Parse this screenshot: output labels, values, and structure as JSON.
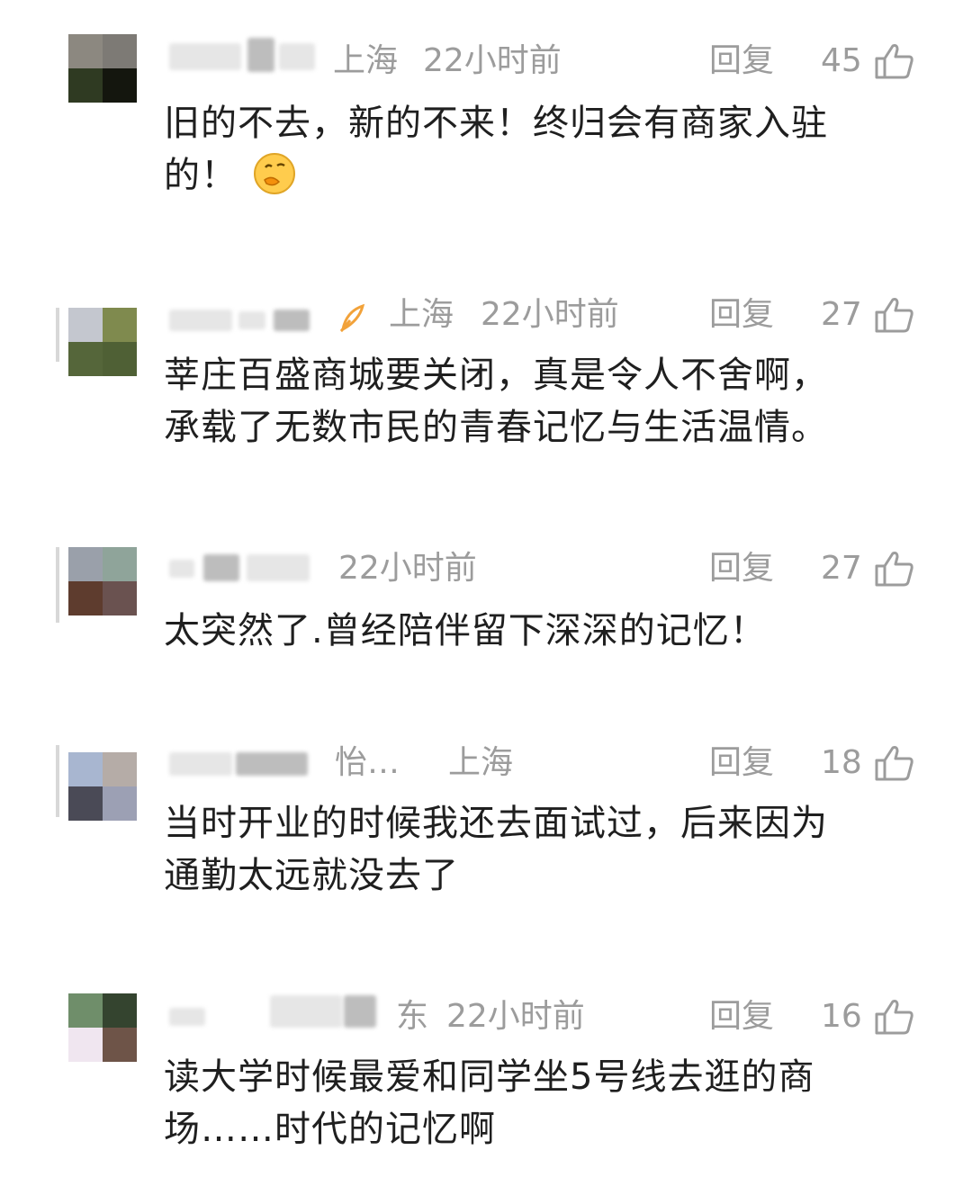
{
  "comments": [
    {
      "location": "上海",
      "time": "22小时前",
      "reply_label": "回复",
      "likes": "45",
      "lines": [
        "旧的不去，新的不来！终归会有商家入驻",
        "的！"
      ],
      "emoji": "thinking-face-emoji"
    },
    {
      "location": "上海",
      "time": "22小时前",
      "reply_label": "回复",
      "likes": "27",
      "lines": [
        "莘庄百盛商城要关闭，真是令人不舍啊，",
        "承载了无数市民的青春记忆与生活温情。"
      ]
    },
    {
      "time": "22小时前",
      "reply_label": "回复",
      "likes": "27",
      "lines": [
        "太突然了.曾经陪伴留下深深的记忆！"
      ]
    },
    {
      "extra": "怡…",
      "location": "上海",
      "reply_label": "回复",
      "likes": "18",
      "lines": [
        "当时开业的时候我还去面试过，后来因为",
        "通勤太远就没去了"
      ]
    },
    {
      "location_partial": "东",
      "time": "22小时前",
      "reply_label": "回复",
      "likes": "16",
      "lines": [
        "读大学时候最爱和同学坐5号线去逛的商",
        "场……时代的记忆啊"
      ]
    }
  ],
  "colors": {
    "meta_text": "#9c9c9c",
    "body_text": "#1f1f1f",
    "avatars": [
      [
        "#8c8880",
        "#7d7a75",
        "#2f3a22",
        "#14160e"
      ],
      [
        "#c4c7cf",
        "#7f8a4e",
        "#55663a",
        "#4f6035"
      ],
      [
        "#9aa0aa",
        "#8fa49a",
        "#5e3c2e",
        "#6a5250"
      ],
      [
        "#a8b6d0",
        "#b5aca7",
        "#4a4a56",
        "#9ca0b4"
      ],
      [
        "#6f8e6a",
        "#34442f",
        "#f0e6f0",
        "#6e5448"
      ]
    ]
  },
  "icons": {
    "like": "thumbs-up-outline-icon",
    "badge": "orange-leaf-badge-icon"
  }
}
